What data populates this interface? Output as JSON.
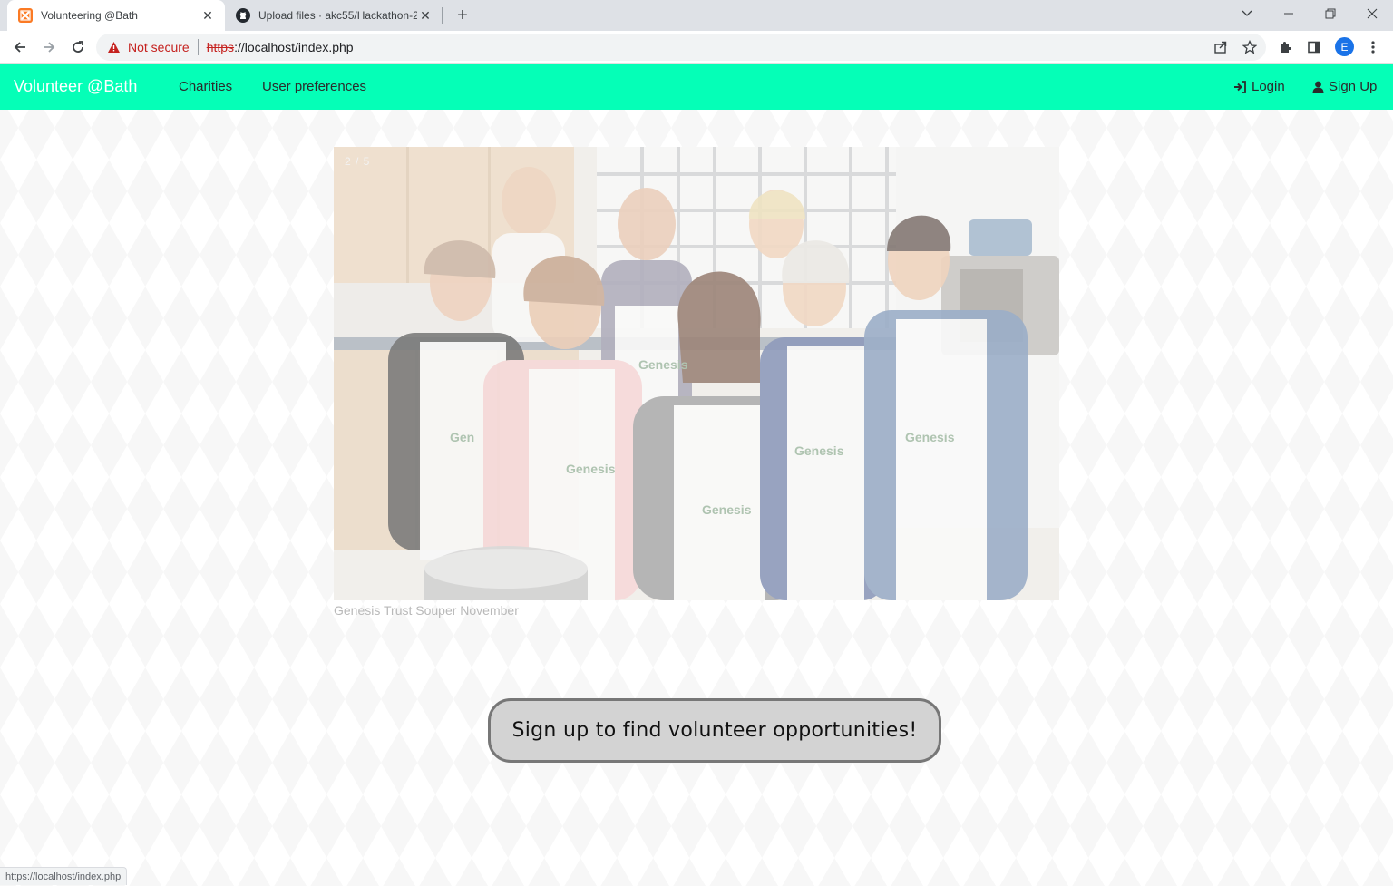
{
  "browser": {
    "tabs": [
      {
        "title": "Volunteering @Bath",
        "icon": "xampp-icon",
        "active": true
      },
      {
        "title": "Upload files · akc55/Hackathon-2",
        "icon": "github-icon",
        "active": false
      }
    ],
    "address": {
      "security_label": "Not secure",
      "scheme": "https",
      "rest": "://localhost/index.php"
    },
    "profile_initial": "E",
    "status_url": "https://localhost/index.php"
  },
  "site": {
    "brand": "Volunteer @Bath",
    "nav": {
      "charities": "Charities",
      "preferences": "User preferences",
      "login": "Login",
      "signup": "Sign Up"
    },
    "colors": {
      "navbar": "#05ffb7",
      "brand_text": "#ffffff"
    },
    "slideshow": {
      "counter": "2 / 5",
      "caption": "Genesis Trust Souper November"
    },
    "cta": "Sign up to find volunteer opportunities!"
  }
}
